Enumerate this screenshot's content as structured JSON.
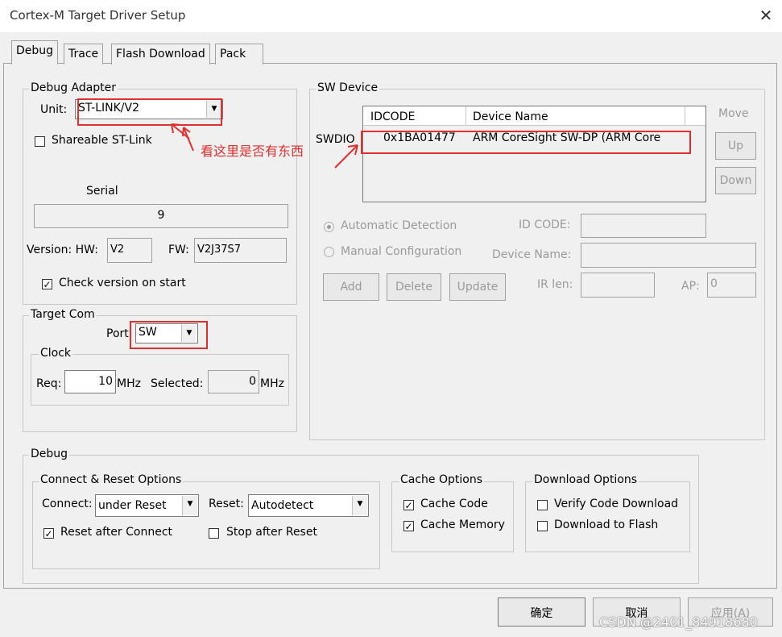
{
  "window": {
    "title": "Cortex-M Target Driver Setup",
    "close_symbol": "✕"
  },
  "tabs": [
    "Debug",
    "Trace",
    "Flash Download",
    "Pack"
  ],
  "debug_adapter": {
    "group_label": "Debug Adapter",
    "unit_label": "Unit:",
    "unit_value": "ST-LINK/V2",
    "shareable_label": "Shareable ST-Link",
    "shareable_checked": false,
    "serial_label": "Serial",
    "serial_value": "9",
    "version_hw_label": "Version: HW:",
    "version_hw_value": "V2",
    "fw_label": "FW:",
    "fw_value": "V2J37S7",
    "check_version_label": "Check version on start",
    "check_version_checked": true
  },
  "target_com": {
    "group_label": "Target Com",
    "port_label": "Port:",
    "port_value": "SW",
    "clock_label": "Clock",
    "req_label": "Req:",
    "req_value": "10",
    "mhz1": "MHz",
    "selected_label": "Selected:",
    "selected_value": "0",
    "mhz2": "MHz"
  },
  "sw_device": {
    "group_label": "SW Device",
    "col_idcode": "IDCODE",
    "col_device_name": "Device Name",
    "row_label": "SWDIO",
    "row_idcode": "0x1BA01477",
    "row_device_name": "ARM CoreSight SW-DP (ARM Core",
    "move_label": "Move",
    "up_label": "Up",
    "down_label": "Down",
    "auto_detect_label": "Automatic Detection",
    "manual_config_label": "Manual Configuration",
    "id_code_label": "ID CODE:",
    "device_name_label": "Device Name:",
    "add_label": "Add",
    "delete_label": "Delete",
    "update_label": "Update",
    "ir_len_label": "IR len:",
    "ap_label": "AP:",
    "ap_value": "0"
  },
  "annotation": {
    "text": "看这里是否有东西",
    "color": "#e03030"
  },
  "debug_section": {
    "group_label": "Debug",
    "connect_reset_label": "Connect & Reset Options",
    "connect_label": "Connect:",
    "connect_value": "under Reset",
    "reset_label": "Reset:",
    "reset_value": "Autodetect",
    "reset_after_connect_label": "Reset after Connect",
    "stop_after_reset_label": "Stop after Reset",
    "cache_options_label": "Cache Options",
    "cache_code_label": "Cache Code",
    "cache_memory_label": "Cache Memory",
    "download_options_label": "Download Options",
    "verify_code_label": "Verify Code Download",
    "download_flash_label": "Download to Flash"
  },
  "footer": {
    "ok_label": "确定",
    "cancel_label": "取消",
    "apply_label": "应用(A)",
    "watermark": "CSDN @2401_84918680"
  },
  "check_mark": "✓",
  "combo_arrow": "▼"
}
